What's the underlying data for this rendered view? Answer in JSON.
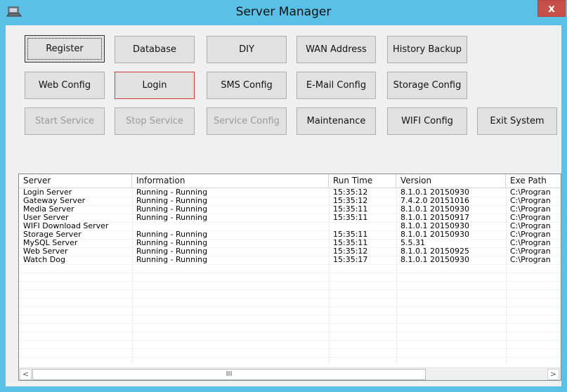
{
  "window": {
    "title": "Server Manager",
    "close_glyph": "x"
  },
  "buttons": {
    "register": "Register",
    "database": "Database",
    "diy": "DIY",
    "wan_address": "WAN Address",
    "history_backup": "History Backup",
    "web_config": "Web Config",
    "login": "Login",
    "sms_config": "SMS Config",
    "email_config": "E-Mail Config",
    "storage_config": "Storage Config",
    "start_service": "Start Service",
    "stop_service": "Stop Service",
    "service_config": "Service Config",
    "maintenance": "Maintenance",
    "wifi_config": "WIFI Config",
    "exit_system": "Exit System"
  },
  "table": {
    "columns": [
      "Server",
      "Information",
      "Run Time",
      "Version",
      "Exe Path"
    ],
    "rows": [
      [
        "Login Server",
        "Running - Running",
        "15:35:12",
        "8.1.0.1 20150930",
        "C:\\Progran"
      ],
      [
        "Gateway Server",
        "Running - Running",
        "15:35:12",
        "7.4.2.0 20151016",
        "C:\\Progran"
      ],
      [
        "Media Server",
        "Running - Running",
        "15:35:11",
        "8.1.0.1 20150930",
        "C:\\Progran"
      ],
      [
        "User Server",
        "Running - Running",
        "15:35:11",
        "8.1.0.1 20150917",
        "C:\\Progran"
      ],
      [
        "WIFI Download Server",
        "",
        "",
        "8.1.0.1 20150930",
        "C:\\Progran"
      ],
      [
        "Storage Server",
        "Running - Running",
        "15:35:11",
        "8.1.0.1 20150930",
        "C:\\Progran"
      ],
      [
        "MySQL Server",
        "Running - Running",
        "15:35:11",
        "5.5.31",
        "C:\\Progran"
      ],
      [
        "Web Server",
        "Running - Running",
        "15:35:12",
        "8.1.0.1 20150925",
        "C:\\Progran"
      ],
      [
        "Watch Dog",
        "Running - Running",
        "15:35:17",
        "8.1.0.1 20150930",
        "C:\\Progran"
      ]
    ]
  },
  "scrollbar": {
    "left_arrow": "<",
    "right_arrow": ">",
    "thumb_grip": "III"
  },
  "colors": {
    "titlebar": "#5bc0e6",
    "close": "#c7504a",
    "focus_red": "#d23a3a"
  }
}
